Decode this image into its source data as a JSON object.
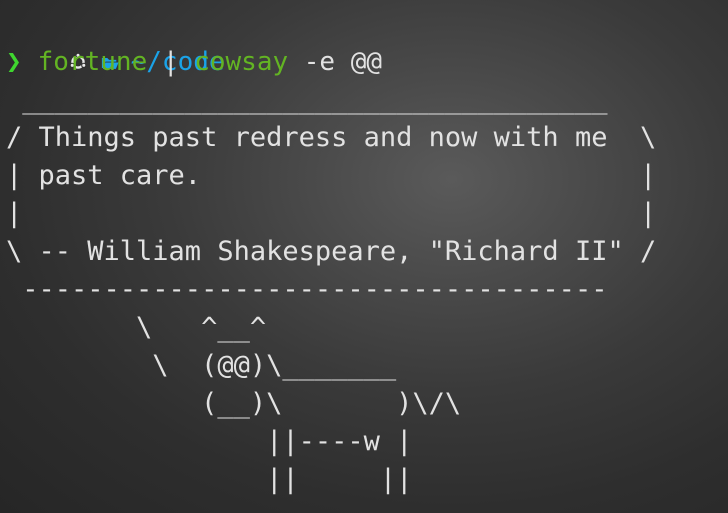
{
  "prompt": {
    "os_icon": "ubuntu-logo-icon",
    "folder_icon": "folder-open-icon",
    "cwd": "~/code",
    "symbol": "❯"
  },
  "command": {
    "program1": "fortune",
    "pipe": "|",
    "program2": "cowsay",
    "args": "-e @@"
  },
  "output": {
    "lines": [
      " ____________________________________",
      "/ Things past redress and now with me  \\",
      "| past care.                           |",
      "|                                      |",
      "\\ -- William Shakespeare, \"Richard II\" /",
      " ------------------------------------",
      "        \\   ^__^",
      "         \\  (@@)\\_______",
      "            (__)\\       )\\/\\",
      "                ||----w |",
      "                ||     ||"
    ]
  },
  "colors": {
    "cwd": "#1aa3e8",
    "prompt_symbol": "#3fd62f",
    "command": "#63b423",
    "text": "#e2e2e2"
  }
}
